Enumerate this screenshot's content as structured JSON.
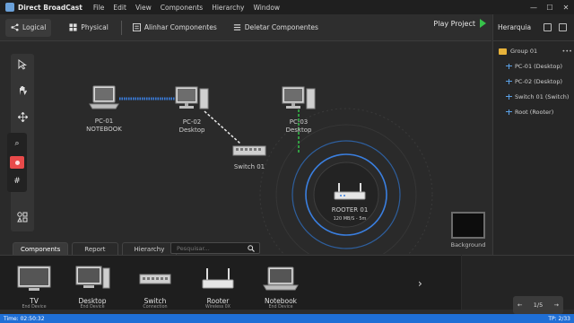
{
  "app": {
    "title": "Direct BroadCast",
    "menu": [
      "File",
      "Edit",
      "View",
      "Components",
      "Hierarchy",
      "Window"
    ]
  },
  "window_controls": {
    "minimize": "—",
    "maximize": "☐",
    "close": "✕"
  },
  "toolbar": {
    "logical_label": "Logical",
    "physical_label": "Physical",
    "align_label": "Alinhar Componentes",
    "delete_label": "Deletar Componentes",
    "play_label": "Play Project"
  },
  "hierarchy": {
    "title": "Herarquia",
    "group": "Group 01",
    "menu_glyph": "•••",
    "items": [
      "PC-01 (Desktop)",
      "PC-02 (Desktop)",
      "Switch 01 (Switch)",
      "Root (Rooter)"
    ]
  },
  "canvas": {
    "devices": {
      "pc01": {
        "name": "PC-01",
        "type": "NOTEBOOK"
      },
      "pc02": {
        "name": "PC-02",
        "type": "Desktop"
      },
      "pc03": {
        "name": "PC-03",
        "type": "Desktop"
      },
      "switch": {
        "name": "Switch 01"
      },
      "router": {
        "name": "ROOTER 01",
        "speed": "120 MB/S - 5m"
      }
    },
    "background_label": "Background"
  },
  "tools": {
    "zoom_glyph": "⌕",
    "grid_glyph": "#"
  },
  "tabs": [
    "Components",
    "Report",
    "Hierarchy"
  ],
  "search": {
    "placeholder": "Pesquisar...",
    "value": ""
  },
  "components": [
    {
      "name": "TV",
      "sub": "End Device"
    },
    {
      "name": "Desktop",
      "sub": "End Device"
    },
    {
      "name": "Switch",
      "sub": "Connection"
    },
    {
      "name": "Rooter",
      "sub": "Wireless 0X"
    },
    {
      "name": "Notebook",
      "sub": "End Device"
    }
  ],
  "tray_next": "›",
  "pager": {
    "prev": "←",
    "label": "1/5",
    "next": "→"
  },
  "status": {
    "time": "Time: 02:50:32",
    "tp": "TP: 2/33"
  },
  "colors": {
    "accent": "#1f6fd6",
    "play": "#37c24a",
    "link_blue": "#3a7fe0",
    "link_green": "#35c24a",
    "record": "#e84a4a"
  }
}
